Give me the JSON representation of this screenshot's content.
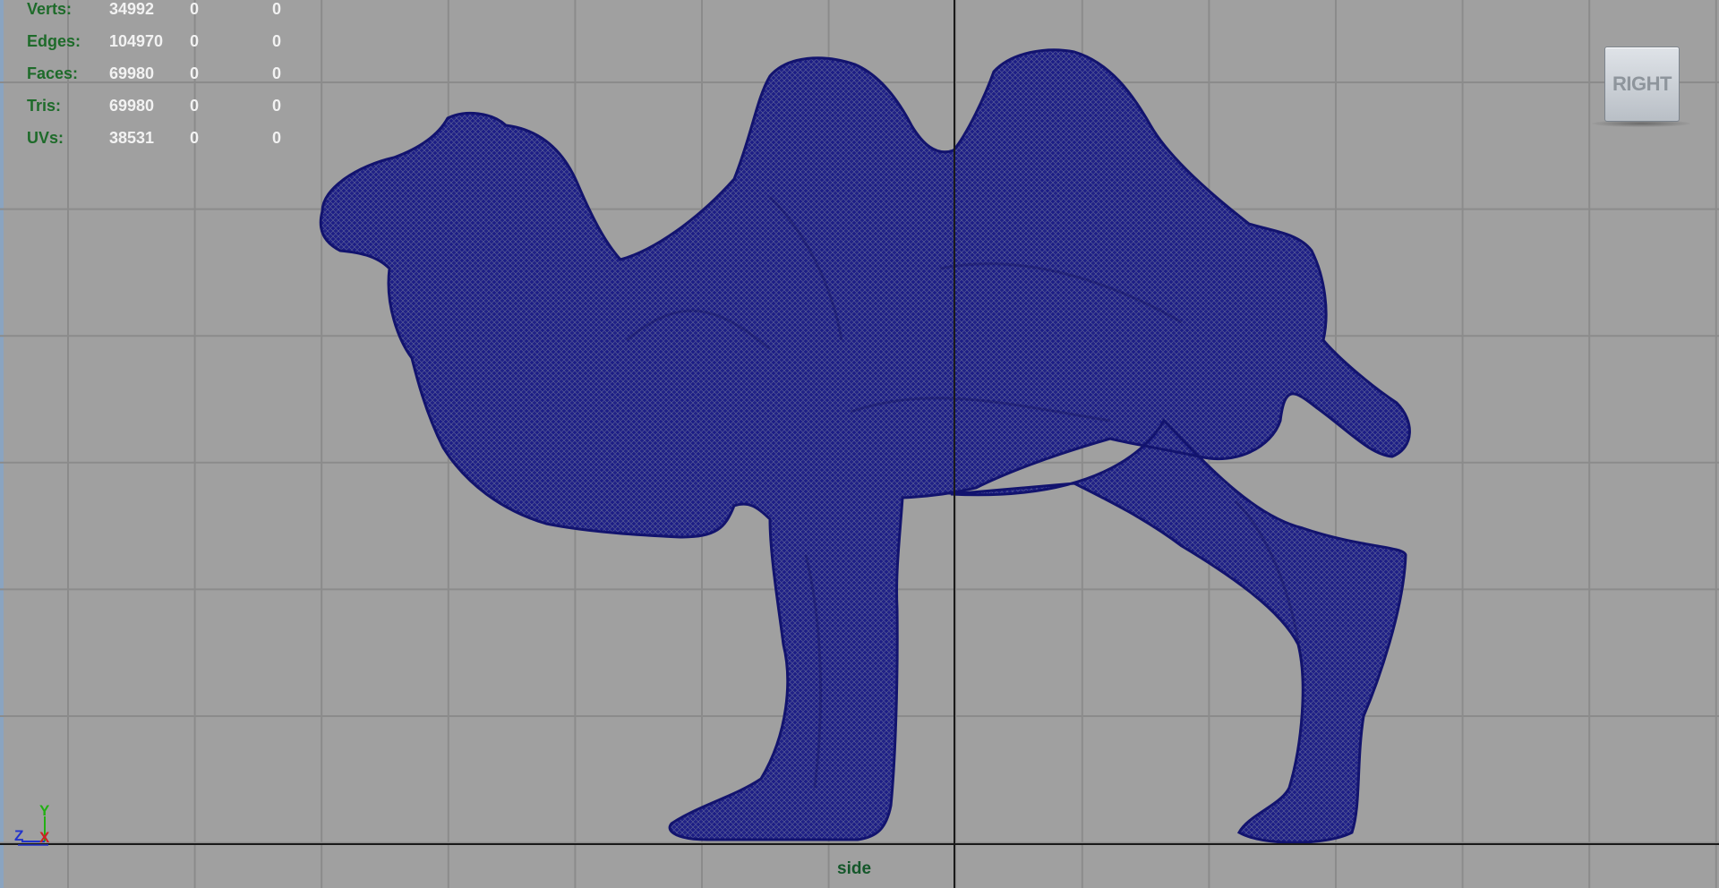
{
  "hud": {
    "rows": [
      {
        "label": "Verts:",
        "values": [
          "34992",
          "0",
          "0"
        ]
      },
      {
        "label": "Edges:",
        "values": [
          "104970",
          "0",
          "0"
        ]
      },
      {
        "label": "Faces:",
        "values": [
          "69980",
          "0",
          "0"
        ]
      },
      {
        "label": "Tris:",
        "values": [
          "69980",
          "0",
          "0"
        ]
      },
      {
        "label": "UVs:",
        "values": [
          "38531",
          "0",
          "0"
        ]
      }
    ]
  },
  "view_cube": {
    "label": "RIGHT"
  },
  "camera": {
    "name": "side"
  },
  "axes": {
    "y": "Y",
    "z": "Z",
    "x": "X"
  },
  "colors": {
    "background": "#a0a0a0",
    "grid": "#8b8b8b",
    "origin_axis": "#1a1a1a",
    "mesh": "#17187a",
    "hud_label": "#1e6b2a",
    "hud_value": "#f2f2f2",
    "axis_y": "#22b014",
    "axis_z": "#2233cc",
    "axis_x": "#cc2222"
  }
}
